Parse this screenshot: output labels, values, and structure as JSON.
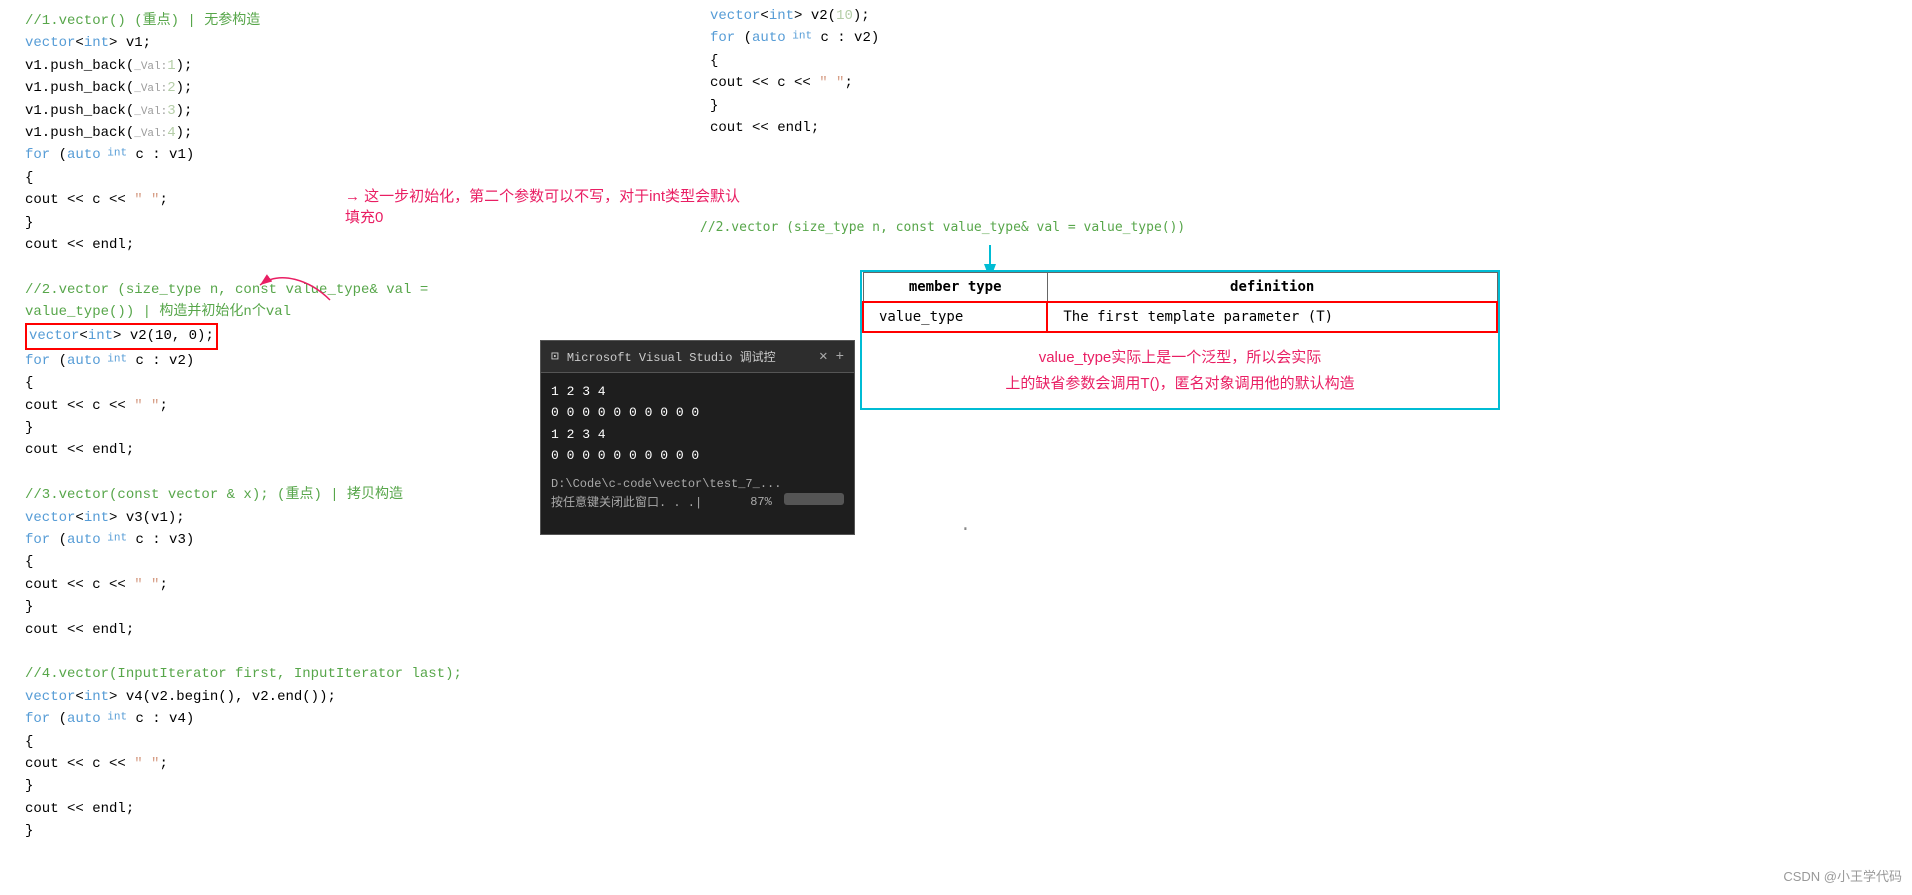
{
  "left_code": {
    "lines": [
      {
        "id": "l1",
        "text": "//1.vector() (重点)  | 无参构造",
        "color": "comment"
      },
      {
        "id": "l2",
        "text": "vector<int> v1;",
        "color": "normal"
      },
      {
        "id": "l3",
        "text": "v1.push_back(_Val:1);",
        "color": "normal"
      },
      {
        "id": "l4",
        "text": "v1.push_back(_Val:2);",
        "color": "normal"
      },
      {
        "id": "l5",
        "text": "v1.push_back(_Val:3);",
        "color": "normal"
      },
      {
        "id": "l6",
        "text": "v1.push_back(_Val:4);",
        "color": "normal"
      },
      {
        "id": "l7",
        "text": "for (auto int c : v1)",
        "color": "normal"
      },
      {
        "id": "l8",
        "text": "{",
        "color": "normal"
      },
      {
        "id": "l9",
        "text": "    cout << c << \" \";",
        "color": "normal"
      },
      {
        "id": "l10",
        "text": "}",
        "color": "normal"
      },
      {
        "id": "l11",
        "text": "cout << endl;",
        "color": "normal"
      },
      {
        "id": "l12",
        "text": "",
        "color": "normal"
      },
      {
        "id": "l13",
        "text": "//2.vector (size_type n, const value_type& val = value_type()) | 构造并初始化n个val",
        "color": "comment"
      },
      {
        "id": "l14",
        "text": "vector<int> v2(10, 0);",
        "color": "normal",
        "highlight": true
      },
      {
        "id": "l15",
        "text": "for (auto int c : v2)",
        "color": "normal"
      },
      {
        "id": "l16",
        "text": "{",
        "color": "normal"
      },
      {
        "id": "l17",
        "text": "    cout << c << \" \";",
        "color": "normal"
      },
      {
        "id": "l18",
        "text": "}",
        "color": "normal"
      },
      {
        "id": "l19",
        "text": "cout << endl;",
        "color": "normal"
      },
      {
        "id": "l20",
        "text": "",
        "color": "normal"
      },
      {
        "id": "l21",
        "text": "//3.vector(const vector & x);  (重点)  | 拷贝构造",
        "color": "comment"
      },
      {
        "id": "l22",
        "text": "vector<int> v3(v1);",
        "color": "normal"
      },
      {
        "id": "l23",
        "text": "for (auto int c : v3)",
        "color": "normal"
      },
      {
        "id": "l24",
        "text": "{",
        "color": "normal"
      },
      {
        "id": "l25",
        "text": "    cout << c << \" \";",
        "color": "normal"
      },
      {
        "id": "l26",
        "text": "}",
        "color": "normal"
      },
      {
        "id": "l27",
        "text": "cout << endl;",
        "color": "normal"
      },
      {
        "id": "l28",
        "text": "",
        "color": "normal"
      },
      {
        "id": "l29",
        "text": "//4.vector(InputIterator first, InputIterator last);",
        "color": "comment"
      },
      {
        "id": "l30",
        "text": "vector<int> v4(v2.begin(), v2.end());",
        "color": "normal"
      },
      {
        "id": "l31",
        "text": "for (auto int c : v4)",
        "color": "normal"
      },
      {
        "id": "l32",
        "text": "{",
        "color": "normal"
      },
      {
        "id": "l33",
        "text": "    cout << c << \" \";",
        "color": "normal"
      },
      {
        "id": "l34",
        "text": "}",
        "color": "normal"
      },
      {
        "id": "l35",
        "text": "cout << endl;",
        "color": "normal"
      },
      {
        "id": "l36",
        "text": "}",
        "color": "normal"
      }
    ]
  },
  "right_code": {
    "lines": [
      {
        "id": "r1",
        "text": "vector<int> v2(10);",
        "color": "normal"
      },
      {
        "id": "r2",
        "text": "for (auto int c : v2)",
        "color": "normal"
      },
      {
        "id": "r3",
        "text": "{",
        "color": "normal"
      },
      {
        "id": "r4",
        "text": "    cout << c << \" \";",
        "color": "normal"
      },
      {
        "id": "r5",
        "text": "}",
        "color": "normal"
      },
      {
        "id": "r6",
        "text": "cout << endl;",
        "color": "normal"
      }
    ]
  },
  "annotation": {
    "arrow_text": "这一步初始化，第二个参数可以不写，对于int类型会默认填充0",
    "table": {
      "headers": [
        "member type",
        "definition"
      ],
      "rows": [
        [
          "value_type",
          "The first template parameter (T)"
        ]
      ]
    },
    "bottom_text": "value_type实际上是一个泛型，所以会实际\n上的缺省参数会调用T()，匿名对象调用他的默认构造"
  },
  "right_comment": "//2.vector (size_type n, const value_type& val = value_type())",
  "terminal": {
    "title": "Microsoft Visual Studio 调试控",
    "output_lines": [
      "1 2 3 4",
      "0 0 0 0 0 0 0 0 0 0",
      "1 2 3 4",
      "0 0 0 0 0 0 0 0 0 0"
    ],
    "path": "D:\\Code\\c-code\\vector\\test_7_...",
    "footer": "按任意键关闭此窗口. . .|",
    "progress": "87%"
  },
  "watermark": "CSDN @小王学代码"
}
